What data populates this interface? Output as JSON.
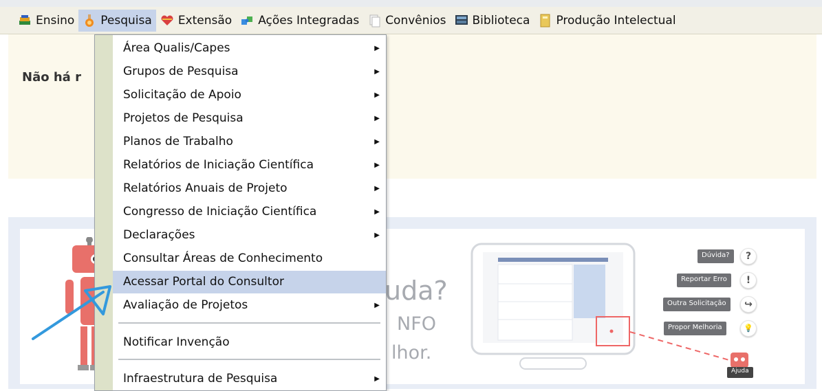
{
  "menubar": {
    "items": [
      {
        "label": "Ensino",
        "icon": "books-icon"
      },
      {
        "label": "Pesquisa",
        "icon": "flask-icon"
      },
      {
        "label": "Extensão",
        "icon": "heart-icon"
      },
      {
        "label": "Ações Integradas",
        "icon": "puzzle-icon"
      },
      {
        "label": "Convênios",
        "icon": "documents-icon"
      },
      {
        "label": "Biblioteca",
        "icon": "monitor-book-icon"
      },
      {
        "label": "Produção Intelectual",
        "icon": "notebook-icon"
      }
    ],
    "active": "Pesquisa"
  },
  "notice": {
    "text": "Não há r"
  },
  "dropdown": {
    "items": [
      {
        "label": "Área Qualis/Capes",
        "submenu": true
      },
      {
        "label": "Grupos de Pesquisa",
        "submenu": true
      },
      {
        "label": "Solicitação de Apoio",
        "submenu": true
      },
      {
        "label": "Projetos de Pesquisa",
        "submenu": true
      },
      {
        "label": "Planos de Trabalho",
        "submenu": true
      },
      {
        "label": "Relatórios de Iniciação Científica",
        "submenu": true
      },
      {
        "label": "Relatórios Anuais de Projeto",
        "submenu": true
      },
      {
        "label": "Congresso de Iniciação Científica",
        "submenu": true
      },
      {
        "label": "Declarações",
        "submenu": true
      },
      {
        "label": "Consultar Áreas de Conhecimento",
        "submenu": false
      },
      {
        "label": "Acessar Portal do Consultor",
        "submenu": false
      },
      {
        "label": "Avaliação de Projetos",
        "submenu": true
      },
      {
        "label": "Notificar Invenção",
        "submenu": false
      },
      {
        "label": "Infraestrutura de Pesquisa",
        "submenu": true
      }
    ],
    "hovered": "Acessar Portal do Consultor",
    "arrow_glyph": "▶"
  },
  "banner": {
    "heading_fragment": "uda?",
    "line1_fragment": "NFO",
    "line2_fragment": "lhor.",
    "buttons": [
      {
        "label": "Dúvida?",
        "glyph": "?"
      },
      {
        "label": "Reportar Erro",
        "glyph": "!"
      },
      {
        "label": "Outra Solicitação",
        "glyph": "↪"
      },
      {
        "label": "Propor Melhoria",
        "glyph": "💡"
      }
    ],
    "robot_tag": "Ajuda"
  },
  "colors": {
    "menubar_bg": "#f2f0e6",
    "highlight": "#c6d3ea",
    "dropdown_gutter": "#dde2c9",
    "notice_bg": "#fcf9ec",
    "robot_red": "#e8706a",
    "pointer_arrow": "#3399dd"
  }
}
